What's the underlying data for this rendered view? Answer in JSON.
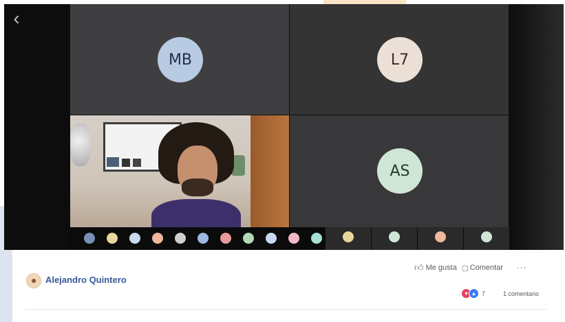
{
  "call": {
    "tiles": [
      {
        "initials": "MB",
        "name": "",
        "avatar_color": "#b8cbe3"
      },
      {
        "initials": "L7",
        "name": "",
        "avatar_color": "#ece0d6"
      },
      {
        "initials": "",
        "name": "",
        "type": "video"
      },
      {
        "initials": "AS",
        "name": "",
        "avatar_color": "#cfe6d6"
      }
    ],
    "strip_chips": [
      {
        "initials": "",
        "color": "#7a8fb5"
      },
      {
        "initials": "",
        "color": "#e8d79a"
      },
      {
        "initials": "",
        "color": "#c9d9ee"
      },
      {
        "initials": "",
        "color": "#f0b79b"
      },
      {
        "initials": "",
        "color": "#cfcfcf"
      },
      {
        "initials": "",
        "color": "#9fb7e0"
      },
      {
        "initials": "",
        "color": "#e89a9a"
      },
      {
        "initials": "",
        "color": "#b6d7b8"
      },
      {
        "initials": "",
        "color": "#c8d8f0"
      },
      {
        "initials": "",
        "color": "#f2b8c6"
      },
      {
        "initials": "",
        "color": "#a8e0d6"
      }
    ],
    "strip_thumbs": [
      {
        "initials": "",
        "color": "#e8d79a",
        "name": ""
      },
      {
        "initials": "",
        "color": "#cfe6d6",
        "name": ""
      },
      {
        "initials": "",
        "color": "#f0b79b",
        "name": ""
      },
      {
        "initials": "",
        "color": "#cfe6d6",
        "name": ""
      }
    ]
  },
  "post": {
    "author": "Alejandro Quintero",
    "actions": {
      "like": "Me gusta",
      "comment": "Comentar",
      "more": "···"
    },
    "reactions": {
      "count": "7",
      "comments": "1 comentario"
    }
  }
}
